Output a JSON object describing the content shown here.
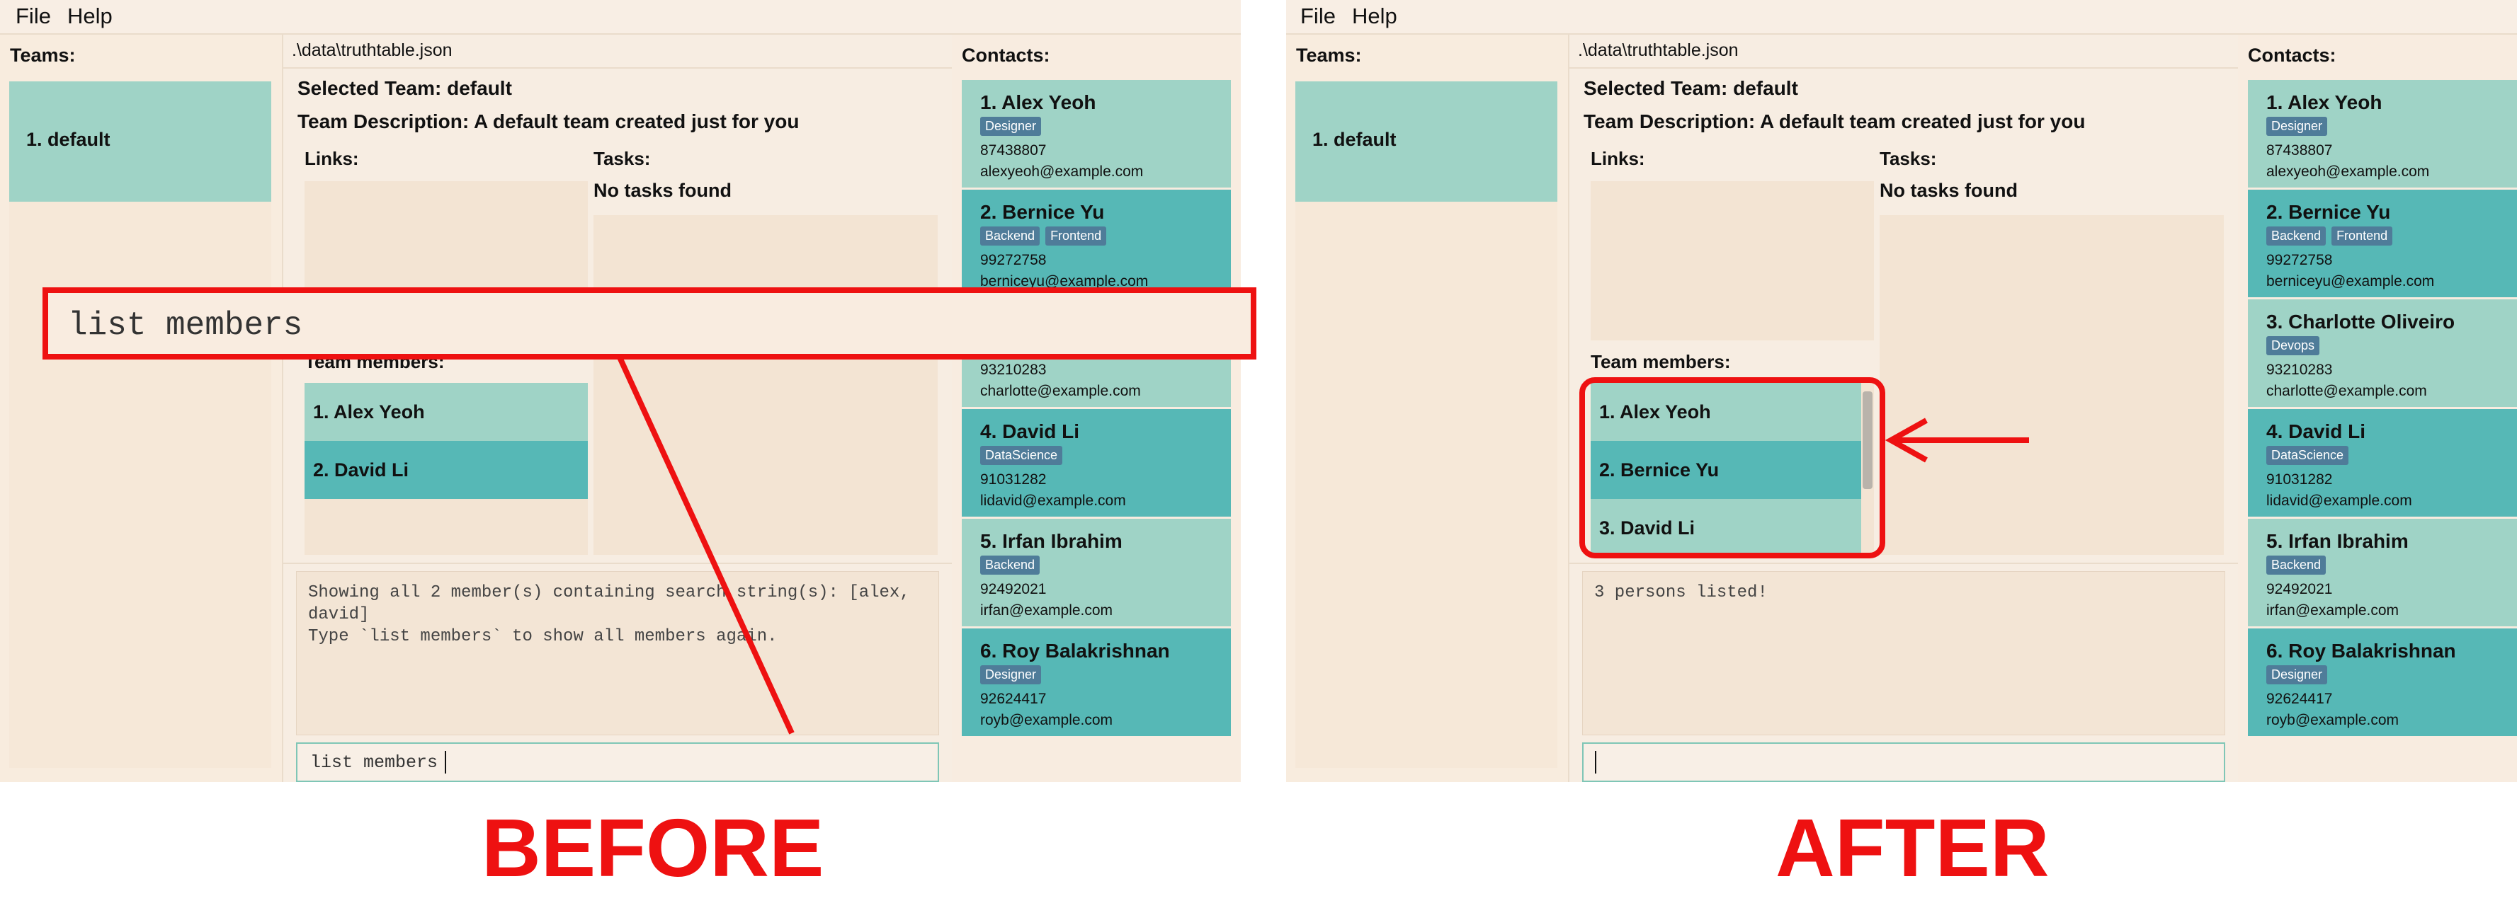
{
  "labels": {
    "before": "BEFORE",
    "after": "AFTER"
  },
  "colors": {
    "annotation_red": "#ee1111",
    "team_card": "#9fd3c6",
    "row_light": "#9fd3c6",
    "row_dark": "#56b8b6",
    "tag": "#4f7c99"
  },
  "before": {
    "menu": {
      "file": "File",
      "help": "Help"
    },
    "teams_title": "Teams:",
    "teams": [
      "1. default"
    ],
    "data_path": ".\\data\\truthtable.json",
    "selected_team": "Selected Team: default",
    "team_description": "Team Description: A default team created just for you",
    "links_label": "Links:",
    "tasks_label": "Tasks:",
    "no_tasks": "No tasks found",
    "team_members_label": "Team members:",
    "team_members": [
      "1. Alex Yeoh",
      "2. David Li"
    ],
    "result": "Showing all 2 member(s) containing search string(s): [alex, david]\nType `list members` to show all members again.",
    "command_input": "list members",
    "callout_text": "list members",
    "contacts_title": "Contacts:",
    "contacts": [
      {
        "name": "1. Alex Yeoh",
        "tags": [
          "Designer"
        ],
        "phone": "87438807",
        "email": "alexyeoh@example.com"
      },
      {
        "name": "2. Bernice Yu",
        "tags": [
          "Backend",
          "Frontend"
        ],
        "phone": "99272758",
        "email": "berniceyu@example.com"
      },
      {
        "name": "3. Charlotte Oliveiro",
        "tags": [
          "Devops"
        ],
        "phone": "93210283",
        "email": "charlotte@example.com"
      },
      {
        "name": "4. David Li",
        "tags": [
          "DataScience"
        ],
        "phone": "91031282",
        "email": "lidavid@example.com"
      },
      {
        "name": "5. Irfan Ibrahim",
        "tags": [
          "Backend"
        ],
        "phone": "92492021",
        "email": "irfan@example.com"
      },
      {
        "name": "6. Roy Balakrishnan",
        "tags": [
          "Designer"
        ],
        "phone": "92624417",
        "email": "royb@example.com"
      }
    ]
  },
  "after": {
    "menu": {
      "file": "File",
      "help": "Help"
    },
    "teams_title": "Teams:",
    "teams": [
      "1. default"
    ],
    "data_path": ".\\data\\truthtable.json",
    "selected_team": "Selected Team: default",
    "team_description": "Team Description: A default team created just for you",
    "links_label": "Links:",
    "tasks_label": "Tasks:",
    "no_tasks": "No tasks found",
    "team_members_label": "Team members:",
    "team_members": [
      "1. Alex Yeoh",
      "2. Bernice Yu",
      "3. David Li"
    ],
    "result": "3 persons listed!",
    "command_input": "",
    "contacts_title": "Contacts:",
    "contacts": [
      {
        "name": "1. Alex Yeoh",
        "tags": [
          "Designer"
        ],
        "phone": "87438807",
        "email": "alexyeoh@example.com"
      },
      {
        "name": "2. Bernice Yu",
        "tags": [
          "Backend",
          "Frontend"
        ],
        "phone": "99272758",
        "email": "berniceyu@example.com"
      },
      {
        "name": "3. Charlotte Oliveiro",
        "tags": [
          "Devops"
        ],
        "phone": "93210283",
        "email": "charlotte@example.com"
      },
      {
        "name": "4. David Li",
        "tags": [
          "DataScience"
        ],
        "phone": "91031282",
        "email": "lidavid@example.com"
      },
      {
        "name": "5. Irfan Ibrahim",
        "tags": [
          "Backend"
        ],
        "phone": "92492021",
        "email": "irfan@example.com"
      },
      {
        "name": "6. Roy Balakrishnan",
        "tags": [
          "Designer"
        ],
        "phone": "92624417",
        "email": "royb@example.com"
      }
    ]
  }
}
